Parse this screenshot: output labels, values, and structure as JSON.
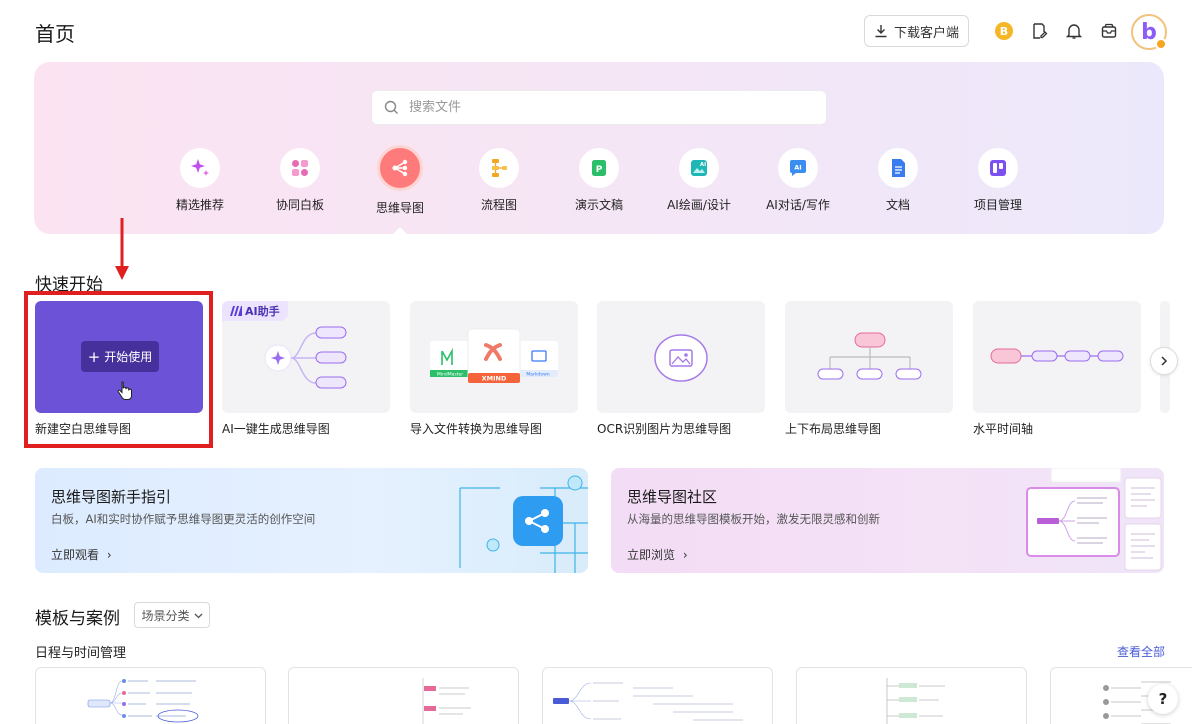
{
  "header": {
    "title": "首页",
    "download_label": "下载客户端",
    "coin_glyph": "B"
  },
  "search": {
    "placeholder": "搜索文件"
  },
  "categories": [
    {
      "label": "精选推荐",
      "icon": "sparkle-icon",
      "color": "#c04ff0"
    },
    {
      "label": "协同白板",
      "icon": "whiteboard-icon",
      "color": "#e86ab5"
    },
    {
      "label": "思维导图",
      "icon": "mindmap-icon",
      "color": "#ff6b6b",
      "active": true
    },
    {
      "label": "流程图",
      "icon": "flowchart-icon",
      "color": "#f5a623"
    },
    {
      "label": "演示文稿",
      "icon": "presentation-icon",
      "color": "#2bbf6a"
    },
    {
      "label": "AI绘画/设计",
      "icon": "ai-paint-icon",
      "color": "#1fb6b6"
    },
    {
      "label": "AI对话/写作",
      "icon": "ai-chat-icon",
      "color": "#3a8ef0"
    },
    {
      "label": "文档",
      "icon": "document-icon",
      "color": "#3a7bf0"
    },
    {
      "label": "项目管理",
      "icon": "kanban-icon",
      "color": "#7b4ff0"
    }
  ],
  "quick_start": {
    "title": "快速开始",
    "start_button": "开始使用",
    "ai_badge": "AI助手",
    "import_badges": [
      "MindMaster",
      "XMIND",
      "Markdown"
    ],
    "cards": [
      {
        "label": "新建空白思维导图"
      },
      {
        "label": "AI一键生成思维导图"
      },
      {
        "label": "导入文件转换为思维导图"
      },
      {
        "label": "OCR识别图片为思维导图"
      },
      {
        "label": "上下布局思维导图"
      },
      {
        "label": "水平时间轴"
      }
    ]
  },
  "banners": {
    "guide": {
      "title": "思维导图新手指引",
      "subtitle": "白板，AI和实时协作赋予思维导图更灵活的创作空间",
      "link": "立即观看"
    },
    "community": {
      "title": "思维导图社区",
      "subtitle": "从海量的思维导图模板开始，激发无限灵感和创新",
      "link": "立即浏览"
    }
  },
  "templates": {
    "title": "模板与案例",
    "scene_filter": "场景分类",
    "group_title": "日程与时间管理",
    "view_all": "查看全部"
  },
  "help_label": "?",
  "colors": {
    "accent_purple": "#6c52d6",
    "annotation_red": "#e02020",
    "link_blue": "#4a5bd8"
  }
}
